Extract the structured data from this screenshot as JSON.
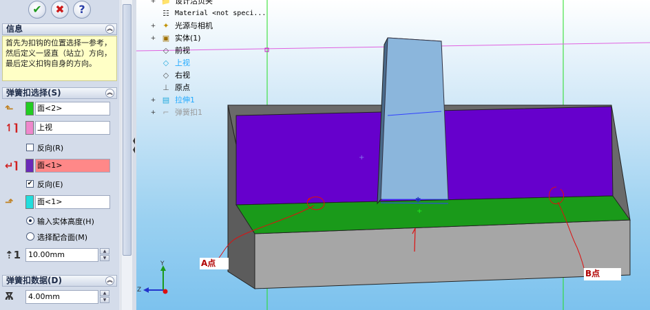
{
  "toolbar": {
    "ok_icon": "check-icon",
    "cancel_icon": "x-icon",
    "help_icon": "question-icon",
    "ok_glyph": "✔",
    "cancel_glyph": "✖",
    "help_glyph": "?"
  },
  "info": {
    "title": "信息",
    "collapse": "︽",
    "text": "首先为扣钩的位置选择一参考，然后定义一竖直（站立）方向，最后定义扣钩自身的方向。"
  },
  "snap_select": {
    "title": "弹簧扣选择(S)",
    "collapse": "︽",
    "face1": {
      "value": "面<2>",
      "color": "#22cc22",
      "icon": "face-select-icon"
    },
    "face2": {
      "value": "上视",
      "color": "#ee88cc",
      "icon": "vertical-direction-icon"
    },
    "reverse1": {
      "label": "反向(R)",
      "checked": false,
      "mark": ""
    },
    "face3": {
      "value": "面<1>",
      "color": "#6a2ab8",
      "icon": "direction-arrow-icon"
    },
    "reverse2": {
      "label": "反向(E)",
      "checked": true,
      "mark": "✔"
    },
    "face4": {
      "value": "面<1>",
      "color": "#22dddd",
      "icon": "hook-direction-icon"
    },
    "radio1": {
      "label": "输入实体高度(H)",
      "selected": true
    },
    "radio2": {
      "label": "选择配合面(M)",
      "selected": false
    },
    "height": {
      "value": "10.00mm",
      "icon": "height-icon"
    }
  },
  "snap_data": {
    "title": "弹簧扣数据(D)",
    "collapse": "︽",
    "width": {
      "value": "4.00mm",
      "icon": "width-icon"
    }
  },
  "spin": {
    "up": "▲",
    "down": "▼"
  },
  "tree": {
    "items": [
      {
        "label": "设计活页夹",
        "icon": "folder-icon",
        "glyph": "📁",
        "expand": "+"
      },
      {
        "label": "Material <not speci...",
        "icon": "material-icon",
        "glyph": "☷",
        "expand": ""
      },
      {
        "label": "光源与相机",
        "icon": "lights-icon",
        "glyph": "✦",
        "expand": "+"
      },
      {
        "label": "实体(1)",
        "icon": "solid-body-icon",
        "glyph": "▣",
        "expand": "+"
      },
      {
        "label": "前视",
        "icon": "plane-icon",
        "glyph": "◇",
        "expand": ""
      },
      {
        "label": "上视",
        "icon": "plane-icon",
        "glyph": "◇",
        "expand": "",
        "highlight": true
      },
      {
        "label": "右视",
        "icon": "plane-icon",
        "glyph": "◇",
        "expand": ""
      },
      {
        "label": "原点",
        "icon": "origin-icon",
        "glyph": "⊥",
        "expand": ""
      },
      {
        "label": "拉伸1",
        "icon": "extrude-icon",
        "glyph": "▤",
        "expand": "+",
        "highlight": true
      },
      {
        "label": "弹簧扣1",
        "icon": "snap-hook-icon",
        "glyph": "⌐",
        "expand": "+",
        "dim": true
      }
    ]
  },
  "triad": {
    "x": "",
    "y": "Y",
    "z": "Z"
  },
  "callouts": {
    "a": "A点",
    "b": "B点"
  },
  "colors": {
    "purple_face": "#6600cc",
    "green_face": "#1a9a1a",
    "gray_body": "#a6a6a6"
  }
}
